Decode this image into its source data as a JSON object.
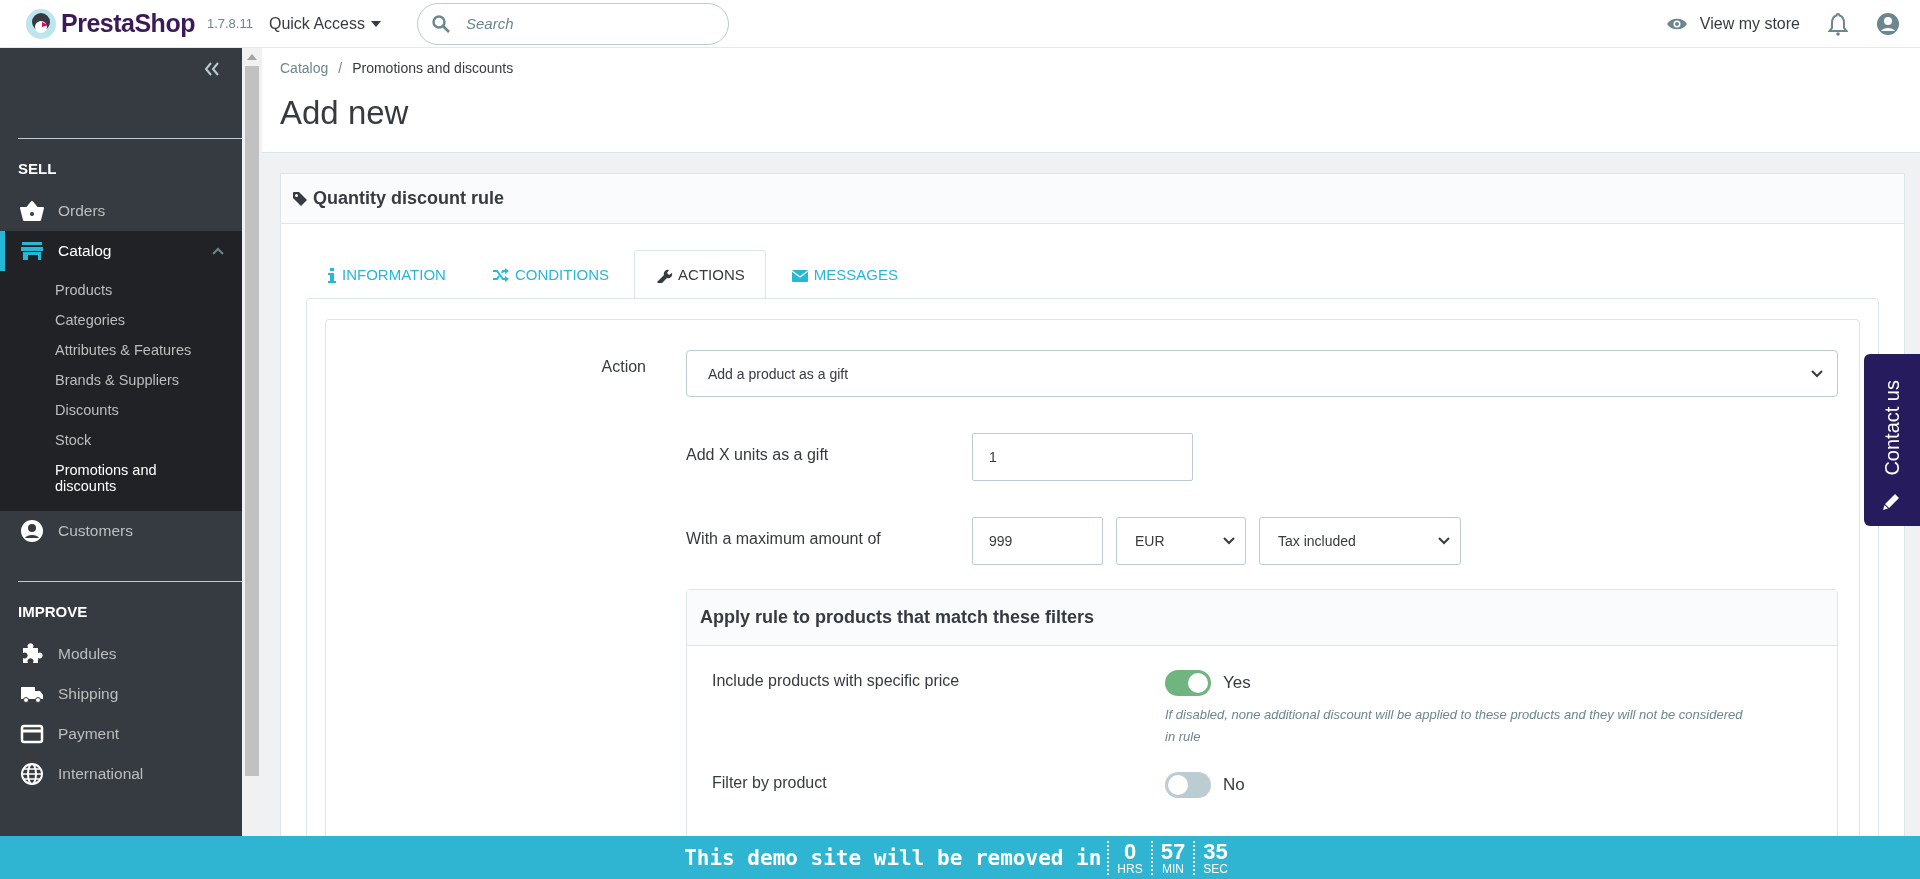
{
  "header": {
    "brand": "PrestaShop",
    "version": "1.7.8.11",
    "quick_access": "Quick Access",
    "search": {
      "placeholder": "Search"
    },
    "view_store": "View my store"
  },
  "sidebar": {
    "sections": [
      {
        "title": "SELL",
        "items": [
          {
            "label": "Orders",
            "selected": false
          },
          {
            "label": "Catalog",
            "selected": true,
            "expanded": true,
            "children": [
              {
                "label": "Products",
                "selected": false
              },
              {
                "label": "Categories",
                "selected": false
              },
              {
                "label": "Attributes & Features",
                "selected": false
              },
              {
                "label": "Brands & Suppliers",
                "selected": false
              },
              {
                "label": "Discounts",
                "selected": false
              },
              {
                "label": "Stock",
                "selected": false
              },
              {
                "label": "Promotions and discounts",
                "selected": true
              }
            ]
          },
          {
            "label": "Customers",
            "selected": false
          }
        ]
      },
      {
        "title": "IMPROVE",
        "items": [
          {
            "label": "Modules",
            "selected": false
          },
          {
            "label": "Shipping",
            "selected": false
          },
          {
            "label": "Payment",
            "selected": false
          },
          {
            "label": "International",
            "selected": false
          }
        ]
      }
    ]
  },
  "breadcrumb": {
    "items": [
      "Catalog",
      "Promotions and discounts"
    ],
    "separator": "/"
  },
  "page_title": "Add new",
  "card": {
    "title": "Quantity discount rule",
    "tabs": [
      {
        "label": "INFORMATION",
        "selected": false
      },
      {
        "label": "CONDITIONS",
        "selected": false
      },
      {
        "label": "ACTIONS",
        "selected": true
      },
      {
        "label": "MESSAGES",
        "selected": false
      }
    ],
    "action": {
      "label": "Action",
      "value": "Add a product as a gift"
    },
    "gift_units": {
      "label": "Add X units as a gift",
      "value": "1"
    },
    "max_amount": {
      "label": "With a maximum amount of",
      "value": "999",
      "currency": "EUR",
      "tax": "Tax included"
    },
    "filters": {
      "title": "Apply rule to products that match these filters",
      "rows": [
        {
          "label": "Include products with specific price",
          "on": true,
          "state_label": "Yes",
          "hint": "If disabled, none additional discount will be applied to these products and they will not be considered in rule"
        },
        {
          "label": "Filter by product",
          "on": false,
          "state_label": "No"
        }
      ]
    }
  },
  "contact_tab": "Contact us",
  "demo_bar": {
    "text": "This demo site will be removed in",
    "counters": [
      {
        "value": "0",
        "unit": "HRS"
      },
      {
        "value": "57",
        "unit": "MIN"
      },
      {
        "value": "35",
        "unit": "SEC"
      }
    ]
  }
}
